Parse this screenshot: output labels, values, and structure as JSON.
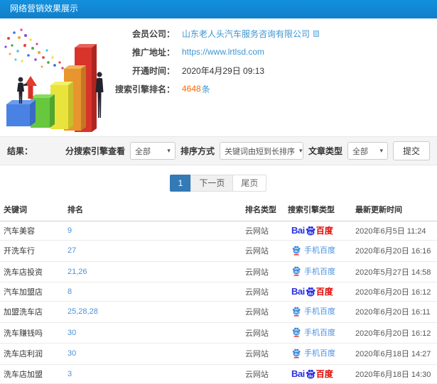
{
  "window": {
    "title": "网络营销效果展示"
  },
  "colors": {
    "header_bg": "#1287d3",
    "accent_blue": "#337ab7",
    "link_blue": "#3d96d2",
    "rank_blue": "#4a90d9",
    "highlight_orange": "#ff6600",
    "baidu_blue": "#2932e1",
    "baidu_red": "#e10601",
    "filter_bar_bg": "#f4f4f4"
  },
  "icons": {
    "caret_down": "▾"
  },
  "info": {
    "rows": [
      {
        "label": "会员公司：",
        "value": "山东老人头汽车服务咨询有限公司"
      },
      {
        "label": "推广地址：",
        "value": "https://www.lrtlsd.com"
      },
      {
        "label": "开通时间：",
        "value": "2020年4月29日 09:13"
      },
      {
        "label": "搜索引擎排名：",
        "value": "4648",
        "suffix": "条"
      }
    ]
  },
  "filters": {
    "result_label": "结果：",
    "engine_view": {
      "label": "分搜索引擎查看",
      "value": "全部"
    },
    "sort": {
      "label": "排序方式",
      "value": "关键词由短到长排序"
    },
    "article_type": {
      "label": "文章类型",
      "value": "全部"
    },
    "submit_label": "提交"
  },
  "pagination": {
    "current": "1",
    "next": "下一页",
    "last": "尾页"
  },
  "logos": {
    "baidu_pc": {
      "bai": "Bai",
      "du": "du",
      "suffix": "百度"
    },
    "baidu_mobile": {
      "du": "du",
      "label": "手机百度"
    }
  },
  "table": {
    "headers": [
      "关键词",
      "排名",
      "排名类型",
      "搜索引擎类型",
      "最新更新时间"
    ],
    "rows": [
      {
        "keyword": "汽车美容",
        "rank": "9",
        "rank_type": "云网站",
        "engine": "baidu-pc",
        "updated": "2020年6月5日 11:24"
      },
      {
        "keyword": "开洗车行",
        "rank": "27",
        "rank_type": "云网站",
        "engine": "baidu-mobile",
        "updated": "2020年6月20日 16:16"
      },
      {
        "keyword": "洗车店投资",
        "rank": "21,26",
        "rank_type": "云网站",
        "engine": "baidu-mobile",
        "updated": "2020年5月27日 14:58"
      },
      {
        "keyword": "汽车加盟店",
        "rank": "8",
        "rank_type": "云网站",
        "engine": "baidu-pc",
        "updated": "2020年6月20日 16:12"
      },
      {
        "keyword": "加盟洗车店",
        "rank": "25,28,28",
        "rank_type": "云网站",
        "engine": "baidu-mobile",
        "updated": "2020年6月20日 16:11"
      },
      {
        "keyword": "洗车赚钱吗",
        "rank": "30",
        "rank_type": "云网站",
        "engine": "baidu-mobile",
        "updated": "2020年6月20日 16:12"
      },
      {
        "keyword": "洗车店利润",
        "rank": "30",
        "rank_type": "云网站",
        "engine": "baidu-mobile",
        "updated": "2020年6月18日 14:27"
      },
      {
        "keyword": "洗车店加盟",
        "rank": "3",
        "rank_type": "云网站",
        "engine": "baidu-pc",
        "updated": "2020年6月18日 14:30"
      }
    ]
  }
}
